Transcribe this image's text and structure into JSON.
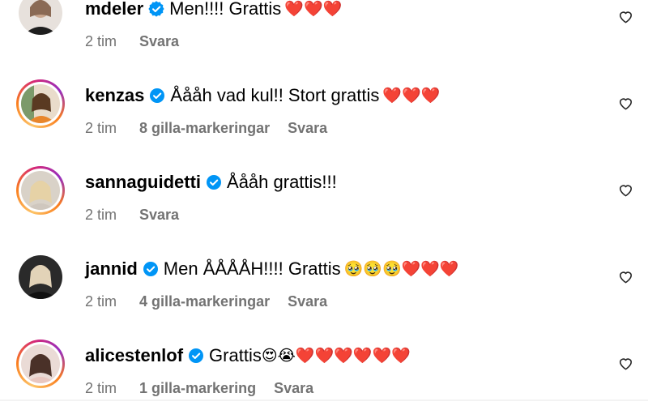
{
  "comments": [
    {
      "username": "mdeler",
      "text": "Men!!!! Grattis",
      "emojis": "❤️❤️❤️",
      "time": "2 tim",
      "likes": "",
      "reply": "Svara",
      "avatar_ring": "plain"
    },
    {
      "username": "kenzas",
      "text": "Åååh vad kul!! Stort grattis",
      "emojis": "❤️❤️❤️",
      "time": "2 tim",
      "likes": "8 gilla-markeringar",
      "reply": "Svara",
      "avatar_ring": "story"
    },
    {
      "username": "sannaguidetti",
      "text": "Åååh grattis!!!",
      "emojis": "",
      "time": "2 tim",
      "likes": "",
      "reply": "Svara",
      "avatar_ring": "story"
    },
    {
      "username": "jannid",
      "text": "Men ÅÅÅÅH!!!! Grattis",
      "emojis": "🥹🥹🥹❤️❤️❤️",
      "time": "2 tim",
      "likes": "4 gilla-markeringar",
      "reply": "Svara",
      "avatar_ring": "plain"
    },
    {
      "username": "alicestenlof",
      "text": "Grattis",
      "emojis": "😍😭❤️❤️❤️❤️❤️❤️",
      "time": "2 tim",
      "likes": "1 gilla-markering",
      "reply": "Svara",
      "avatar_ring": "story"
    }
  ],
  "icons": {
    "verified": "verified-badge-icon",
    "like": "heart-outline-icon"
  },
  "colors": {
    "verified_blue": "#0095f6",
    "meta_gray": "#737373",
    "text": "#000000"
  }
}
